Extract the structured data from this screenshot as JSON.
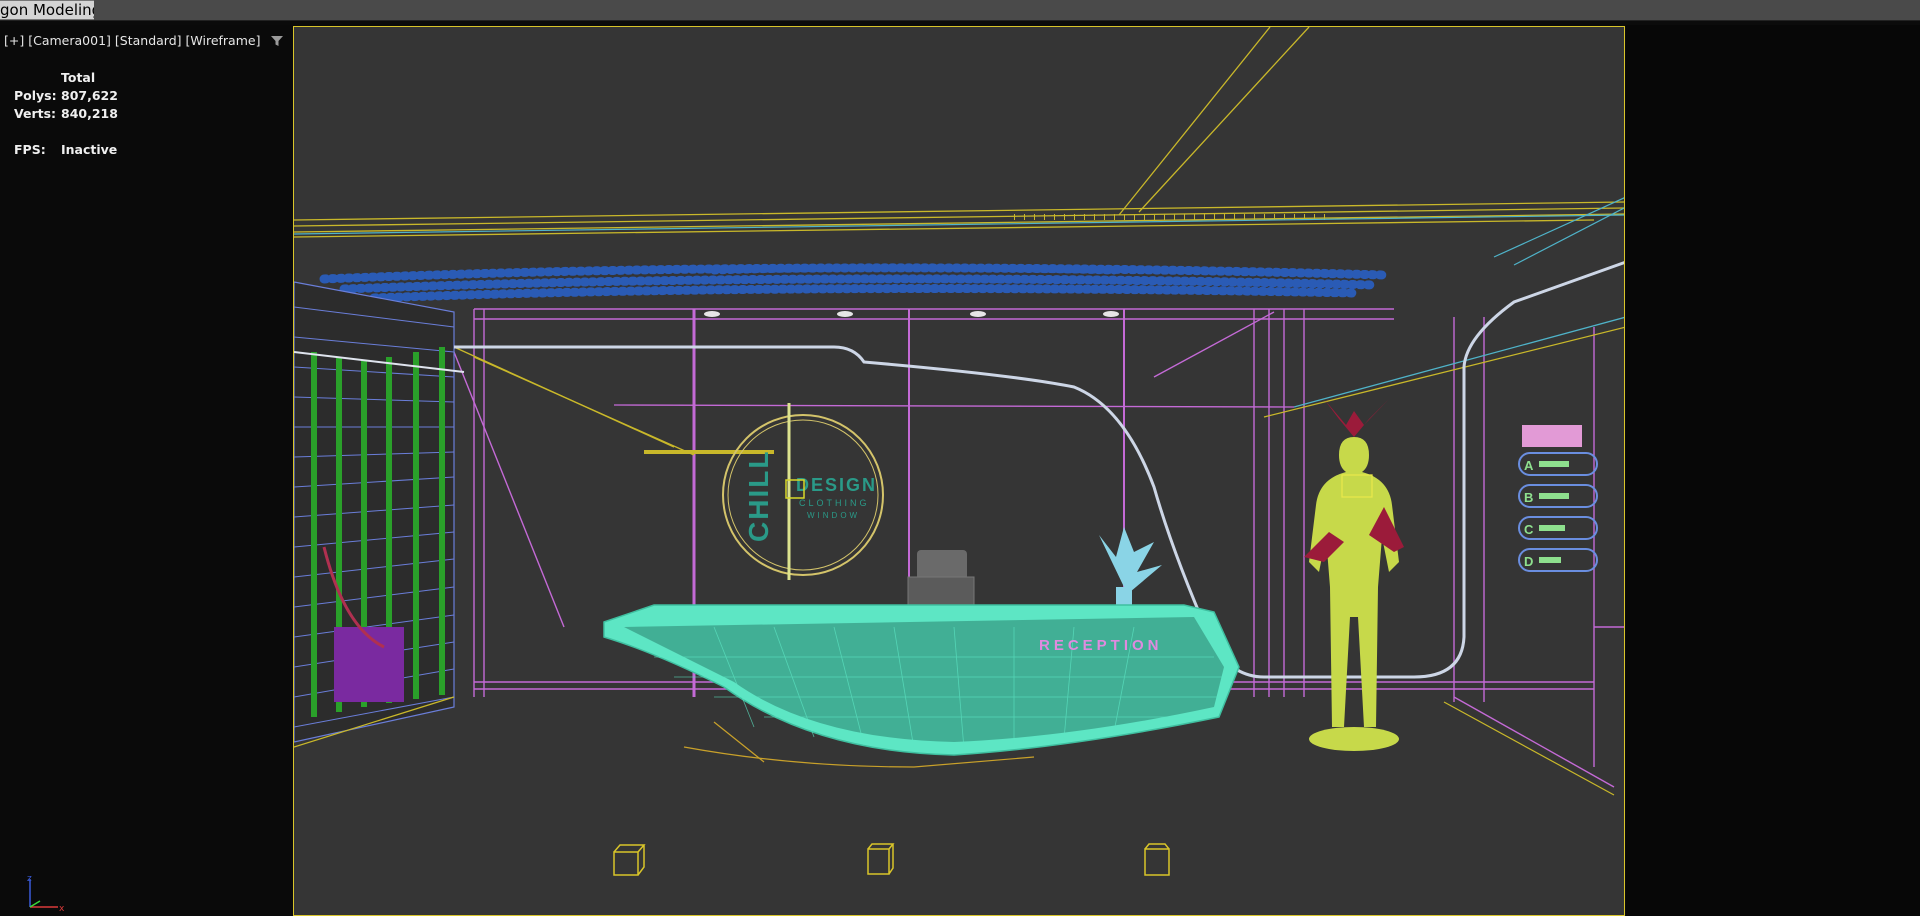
{
  "app": {
    "ribbon_tab_label": "gon Modeling"
  },
  "viewport": {
    "labels": {
      "plus": "[+]",
      "camera": "[Camera001]",
      "shading_standard": "[Standard]",
      "shading_mode": "[Wireframe]"
    },
    "stats": {
      "header": "Total",
      "polys_label": "Polys:",
      "polys_value": "807,622",
      "verts_label": "Verts:",
      "verts_value": "840,218",
      "fps_label": "FPS:",
      "fps_value": "Inactive"
    },
    "axis": {
      "z": "z",
      "x": "x"
    }
  },
  "scene": {
    "logo": {
      "chill": "CHILL",
      "design": "DESIGN",
      "clothing": "CLOTHING",
      "window": "WINDOW"
    },
    "reception_text": "RECEPTION",
    "signboard": {
      "a": "A",
      "b": "B",
      "c": "C",
      "d": "D"
    }
  },
  "colors": {
    "safe_frame": "#d9c52a",
    "viewport_bg": "#353535",
    "desk": "#5de6c4",
    "wall_lines": "#c46ad6",
    "mannequin": "#c7d94a",
    "mannequin_accent": "#9b1b3a",
    "ceiling_dots": "#2a5bb5",
    "wood": "#c9a12a"
  }
}
